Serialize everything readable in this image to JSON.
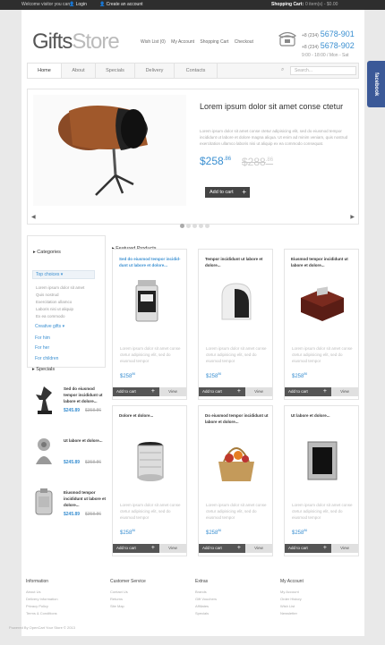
{
  "topbar": {
    "welcome": "Welcome visitor you can",
    "login": "Login",
    "create": "Create an account",
    "cart_label": "Shopping Cart:",
    "cart_items": "0 item(s) - $0.00"
  },
  "header": {
    "logo_a": "Gifts",
    "logo_b": "Store",
    "links": [
      "Wish List (0)",
      "My Account",
      "Shopping Cart",
      "Checkout"
    ],
    "phone_prefix": "+8 (234)",
    "phone1": "5678-901",
    "phone2": "5678-902",
    "hours": "9:00 - 18:00 / Mon - Sat"
  },
  "nav": {
    "tabs": [
      "Home",
      "About",
      "Specials",
      "Delivery",
      "Contacts"
    ],
    "search_placeholder": "Search..."
  },
  "facebook": "facebook",
  "slider": {
    "title": "Lorem ipsum dolor sit amet conse ctetur",
    "desc": "Lorem ipsum dolor sit amet conse ctetur adipisicing elit, sed do eiusmod tempor incididunt ut labore et dolore magna aliqua. Ut enim ad minim veniam, quis nostrud exercitation ullamco laboris nisi ut aliquip ex ea commodo consequat.",
    "price": "$258",
    "price_cents": ".86",
    "old": "$288",
    "old_cents": ".86",
    "button": "Add to cart"
  },
  "sidebar": {
    "categories_title": "Categories",
    "top_choices": "Top choices",
    "subs": [
      "Lorem ipsum dolor sit amet",
      "Quis nostrud",
      "Exercitation ullamco",
      "Laboris nisi ut aliquip",
      "Ex ea commodo"
    ],
    "links": [
      "Creative gifts",
      "For him",
      "For her",
      "For children"
    ],
    "specials_title": "Specials",
    "specials": [
      {
        "title": "Sed do eiusmod tempor incididunt ut labore et dolore...",
        "price": "$245.89",
        "old": "$358.86"
      },
      {
        "title": "Ut labore et dolore...",
        "price": "$245.89",
        "old": "$358.86"
      },
      {
        "title": "Eiusmod tempor incididunt ut labore et dolore...",
        "price": "$245.89",
        "old": "$358.86"
      }
    ]
  },
  "featured": {
    "title": "Featured Products",
    "desc": "Lorem ipsum dolor sit amet conse ctetur adipisicing elit, sed do eiusmod tempor",
    "products": [
      {
        "title": "Sed do eiusmod tempor incidid-dunt ut labore et dolore...",
        "price": "$258",
        "cents": "86",
        "blue": true
      },
      {
        "title": "Tempor incididunt ut labore et dolore...",
        "price": "$258",
        "cents": "86",
        "blue": false
      },
      {
        "title": "Eiusmod tempor incididunt ut labore et dolore...",
        "price": "$258",
        "cents": "86",
        "blue": false
      },
      {
        "title": "Dolore et dolore...",
        "price": "$258",
        "cents": "86",
        "blue": false
      },
      {
        "title": "Do eiusmod tempor incididunt ut labore et dolore...",
        "price": "$258",
        "cents": "86",
        "blue": false
      },
      {
        "title": "Ut labore et dolore...",
        "price": "$258",
        "cents": "86",
        "blue": false
      }
    ],
    "add_label": "Add to cart",
    "view_label": "View"
  },
  "footer": {
    "cols": [
      {
        "title": "Information",
        "items": [
          "About Us",
          "Delivery Information",
          "Privacy Policy",
          "Terms & Conditions"
        ]
      },
      {
        "title": "Customer Service",
        "items": [
          "Contact Us",
          "Returns",
          "Site Map"
        ]
      },
      {
        "title": "Extras",
        "items": [
          "Brands",
          "Gift Vouchers",
          "Affiliates",
          "Specials"
        ]
      },
      {
        "title": "My Account",
        "items": [
          "My Account",
          "Order History",
          "Wish List",
          "Newsletter"
        ]
      }
    ],
    "copyright": "Powered By OpenCart Your Store © 2013"
  }
}
